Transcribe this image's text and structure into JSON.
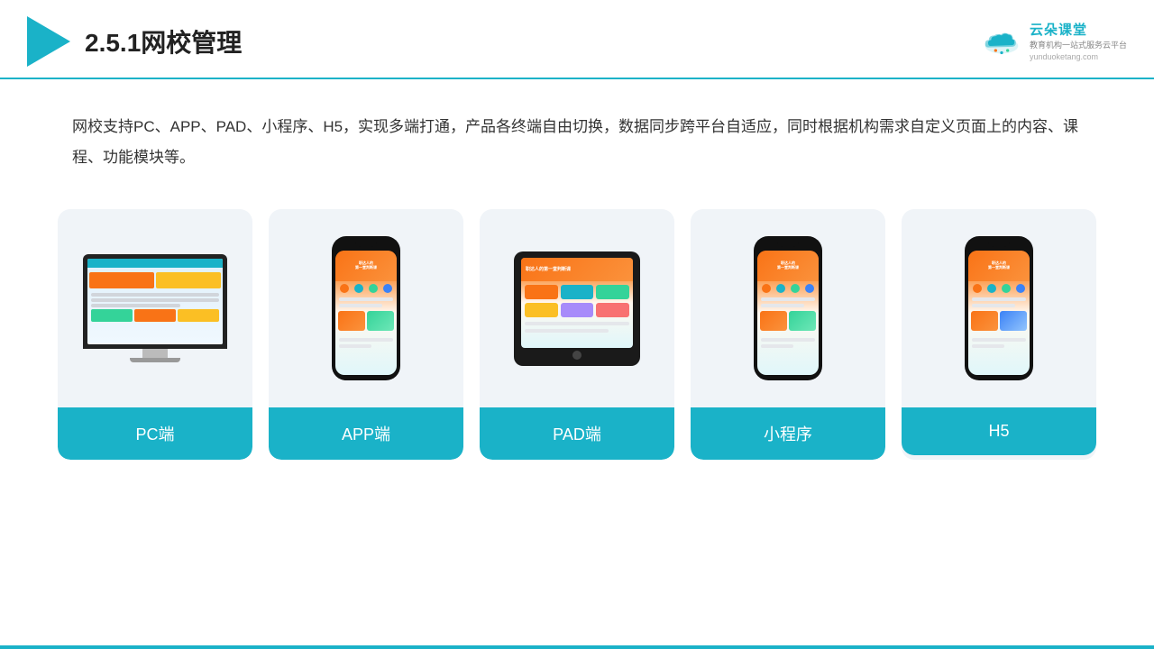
{
  "header": {
    "title": "2.5.1网校管理",
    "logo_name": "云朵课堂",
    "logo_domain": "yunduoketang.com",
    "logo_tagline": "教育机构一站式服务云平台"
  },
  "description": {
    "text": "网校支持PC、APP、PAD、小程序、H5，实现多端打通，产品各终端自由切换，数据同步跨平台自适应，同时根据机构需求自定义页面上的内容、课程、功能模块等。"
  },
  "cards": [
    {
      "id": "pc",
      "label": "PC端",
      "type": "pc"
    },
    {
      "id": "app",
      "label": "APP端",
      "type": "phone"
    },
    {
      "id": "pad",
      "label": "PAD端",
      "type": "pad"
    },
    {
      "id": "miniprogram",
      "label": "小程序",
      "type": "phone"
    },
    {
      "id": "h5",
      "label": "H5",
      "type": "phone"
    }
  ],
  "colors": {
    "accent": "#1ab2c8",
    "orange": "#f97316",
    "dark": "#222",
    "text": "#333"
  }
}
